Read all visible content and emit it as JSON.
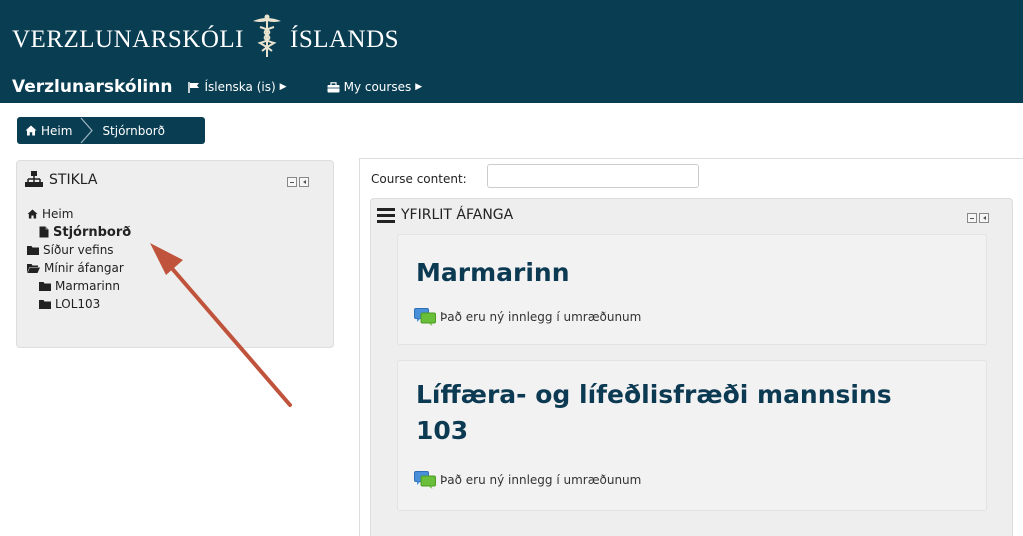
{
  "header": {
    "logo_left": "VERZLUNARSKÓLI",
    "logo_right": "ÍSLANDS",
    "brand": "Verzlunarskólinn",
    "language": "Íslenska (is)",
    "my_courses": "My courses"
  },
  "breadcrumb": [
    "Heim",
    "Stjórnborð"
  ],
  "navigation_block": {
    "title": "STIKLA",
    "items": [
      {
        "label": "Heim",
        "icon": "home-icon"
      },
      {
        "label": "Stjórnborð",
        "icon": "page-icon",
        "current": true
      },
      {
        "label": "Síður vefins",
        "icon": "folder-icon"
      },
      {
        "label": "Mínir áfangar",
        "icon": "folder-open-icon"
      },
      {
        "label": "Marmarinn",
        "icon": "folder-icon"
      },
      {
        "label": "LOL103",
        "icon": "folder-icon"
      }
    ]
  },
  "main": {
    "course_content_label": "Course content:",
    "course_content_value": "",
    "overview_title": "YFIRLIT ÁFANGA",
    "courses": [
      {
        "name": "Marmarinn",
        "notice": "Það eru ný innlegg í umræðunum"
      },
      {
        "name_line1": "Líffæra- og lífeðlisfræði mannsins",
        "name_line2": "103",
        "notice": "Það eru ný innlegg í umræðunum"
      }
    ]
  },
  "colors": {
    "header_bg": "#083d52",
    "course_title": "#0c3a52",
    "arrow": "#c0533b",
    "forum_icon_blue": "#4a90d9",
    "forum_icon_green": "#6abf3a"
  }
}
